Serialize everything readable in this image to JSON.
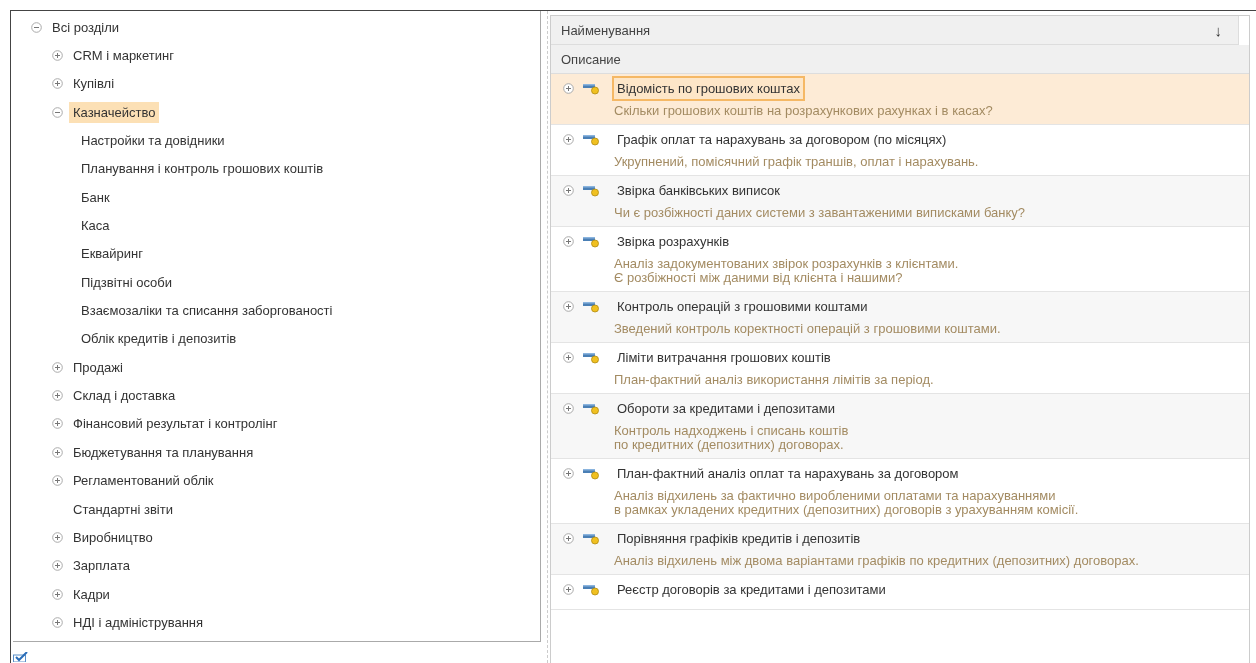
{
  "sections_tree": [
    {
      "label": "Всі розділи",
      "kind": "group",
      "expanded": true,
      "selected": false,
      "children": [
        {
          "label": "CRM і маркетинг",
          "kind": "group",
          "expanded": false,
          "selected": false
        },
        {
          "label": "Купівлі",
          "kind": "group",
          "expanded": false,
          "selected": false
        },
        {
          "label": "Казначейство",
          "kind": "group",
          "expanded": true,
          "selected": true,
          "children": [
            {
              "label": "Настройки та довідники",
              "kind": "leaf",
              "selected": false
            },
            {
              "label": "Планування і контроль грошових коштів",
              "kind": "leaf",
              "selected": false
            },
            {
              "label": "Банк",
              "kind": "leaf",
              "selected": false
            },
            {
              "label": "Каса",
              "kind": "leaf",
              "selected": false
            },
            {
              "label": "Еквайринг",
              "kind": "leaf",
              "selected": false
            },
            {
              "label": "Підзвітні особи",
              "kind": "leaf",
              "selected": false
            },
            {
              "label": "Взаємозаліки та списання заборгованості",
              "kind": "leaf",
              "selected": false
            },
            {
              "label": "Облік кредитів і депозитів",
              "kind": "leaf",
              "selected": false
            }
          ]
        },
        {
          "label": "Продажі",
          "kind": "group",
          "expanded": false,
          "selected": false
        },
        {
          "label": "Склад і доставка",
          "kind": "group",
          "expanded": false,
          "selected": false
        },
        {
          "label": "Фінансовий результат і контролінг",
          "kind": "group",
          "expanded": false,
          "selected": false
        },
        {
          "label": "Бюджетування та планування",
          "kind": "group",
          "expanded": false,
          "selected": false
        },
        {
          "label": "Регламентований облік",
          "kind": "group",
          "expanded": false,
          "selected": false
        },
        {
          "label": "Стандартні звіти",
          "kind": "leaf",
          "selected": false
        },
        {
          "label": "Виробництво",
          "kind": "group",
          "expanded": false,
          "selected": false
        },
        {
          "label": "Зарплата",
          "kind": "group",
          "expanded": false,
          "selected": false
        },
        {
          "label": "Кадри",
          "kind": "group",
          "expanded": false,
          "selected": false
        },
        {
          "label": "НДІ і адміністрування",
          "kind": "group",
          "expanded": false,
          "selected": false
        }
      ]
    }
  ],
  "reports_table": {
    "columns": [
      {
        "label": "Найменування",
        "sort_mark": "↓"
      },
      {
        "label": "Описание"
      }
    ],
    "rows": [
      {
        "title": "Відомість по грошових коштах",
        "description": [
          "Скільки грошових коштів на розрахункових рахунках і в касах?"
        ],
        "selected": true,
        "expanded": false
      },
      {
        "title": "Графік оплат та нарахувань за договором (по місяцях)",
        "description": [
          "Укрупнений, помісячний графік траншів, оплат і нарахувань."
        ],
        "selected": false,
        "expanded": false
      },
      {
        "title": "Звірка банківських виписок",
        "description": [
          "Чи є розбіжності даних системи з завантаженими виписками банку?"
        ],
        "selected": false,
        "expanded": false
      },
      {
        "title": "Звірка розрахунків",
        "description": [
          "Аналіз задокументованих звірок розрахунків з клієнтами.",
          "Є розбіжності між даними від клієнта і нашими?"
        ],
        "selected": false,
        "expanded": false
      },
      {
        "title": "Контроль операцій з грошовими коштами",
        "description": [
          "Зведений контроль коректності операцій з грошовими коштами."
        ],
        "selected": false,
        "expanded": false
      },
      {
        "title": "Ліміти витрачання грошових коштів",
        "description": [
          "План-фактний аналіз використання лімітів за період."
        ],
        "selected": false,
        "expanded": false
      },
      {
        "title": "Обороти за кредитами і депозитами",
        "description": [
          "Контроль надходжень і списань коштів",
          "по кредитних (депозитних) договорах."
        ],
        "selected": false,
        "expanded": false
      },
      {
        "title": "План-фактний аналіз оплат та нарахувань за договором",
        "description": [
          "Аналіз відхилень за фактично виробленими оплатами та нарахуваннями",
          "в рамках укладених кредитних (депозитних) договорів з урахуванням комісії."
        ],
        "selected": false,
        "expanded": false
      },
      {
        "title": "Порівняння графіків кредитів і депозитів",
        "description": [
          "Аналіз відхилень між двома варіантами графіків по кредитних (депозитних) договорах."
        ],
        "selected": false,
        "expanded": false
      },
      {
        "title": "Реєстр договорів за кредитами і депозитами",
        "description": [],
        "selected": false,
        "expanded": false
      }
    ]
  }
}
